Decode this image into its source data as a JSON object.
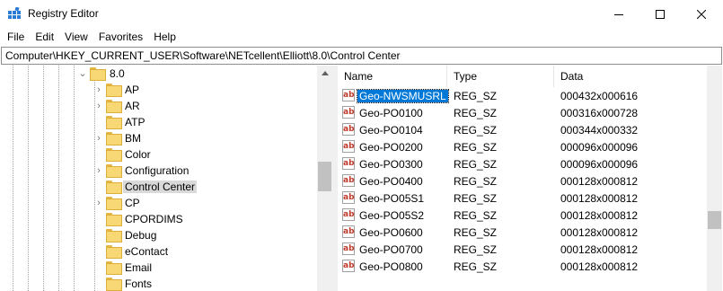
{
  "window": {
    "title": "Registry Editor",
    "icon": "registry-icon"
  },
  "menu": [
    "File",
    "Edit",
    "View",
    "Favorites",
    "Help"
  ],
  "address": "Computer\\HKEY_CURRENT_USER\\Software\\NETcellent\\Elliott\\8.0\\Control Center",
  "tree": {
    "parent": {
      "label": "8.0",
      "expanded": true
    },
    "items": [
      {
        "label": "AP",
        "has_children": true,
        "selected": false
      },
      {
        "label": "AR",
        "has_children": true,
        "selected": false
      },
      {
        "label": "ATP",
        "has_children": false,
        "selected": false
      },
      {
        "label": "BM",
        "has_children": true,
        "selected": false
      },
      {
        "label": "Color",
        "has_children": false,
        "selected": false
      },
      {
        "label": "Configuration",
        "has_children": true,
        "selected": false
      },
      {
        "label": "Control Center",
        "has_children": false,
        "selected": true
      },
      {
        "label": "CP",
        "has_children": true,
        "selected": false
      },
      {
        "label": "CPORDIMS",
        "has_children": false,
        "selected": false
      },
      {
        "label": "Debug",
        "has_children": false,
        "selected": false
      },
      {
        "label": "eContact",
        "has_children": false,
        "selected": false
      },
      {
        "label": "Email",
        "has_children": false,
        "selected": false
      },
      {
        "label": "Fonts",
        "has_children": false,
        "selected": false
      }
    ]
  },
  "list": {
    "columns": [
      "Name",
      "Type",
      "Data"
    ],
    "rows": [
      {
        "name": "Geo-NWSMUSRL",
        "type": "REG_SZ",
        "data": "000432x000616",
        "selected": true
      },
      {
        "name": "Geo-PO0100",
        "type": "REG_SZ",
        "data": "000316x000728",
        "selected": false
      },
      {
        "name": "Geo-PO0104",
        "type": "REG_SZ",
        "data": "000344x000332",
        "selected": false
      },
      {
        "name": "Geo-PO0200",
        "type": "REG_SZ",
        "data": "000096x000096",
        "selected": false
      },
      {
        "name": "Geo-PO0300",
        "type": "REG_SZ",
        "data": "000096x000096",
        "selected": false
      },
      {
        "name": "Geo-PO0400",
        "type": "REG_SZ",
        "data": "000128x000812",
        "selected": false
      },
      {
        "name": "Geo-PO05S1",
        "type": "REG_SZ",
        "data": "000128x000812",
        "selected": false
      },
      {
        "name": "Geo-PO05S2",
        "type": "REG_SZ",
        "data": "000128x000812",
        "selected": false
      },
      {
        "name": "Geo-PO0600",
        "type": "REG_SZ",
        "data": "000128x000812",
        "selected": false
      },
      {
        "name": "Geo-PO0700",
        "type": "REG_SZ",
        "data": "000128x000812",
        "selected": false
      },
      {
        "name": "Geo-PO0800",
        "type": "REG_SZ",
        "data": "000128x000812",
        "selected": false
      }
    ],
    "value_icon_text": "ab"
  },
  "colors": {
    "selection_blue": "#0078d7",
    "tree_selection": "#d9d9d9",
    "folder": "#f8d775"
  }
}
